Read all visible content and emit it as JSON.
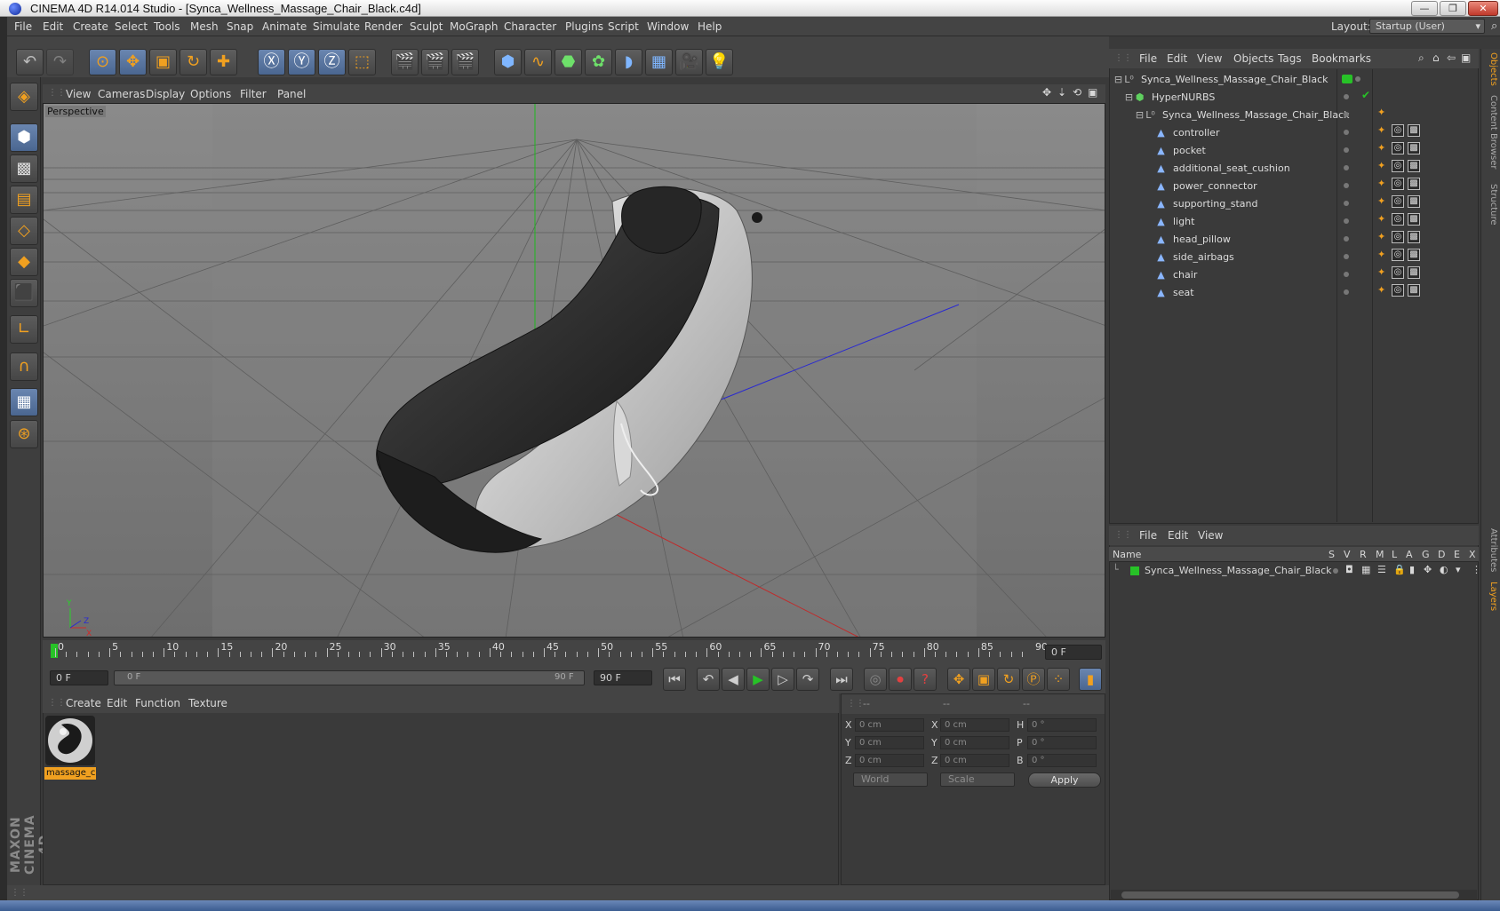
{
  "window": {
    "title": "CINEMA 4D R14.014 Studio - [Synca_Wellness_Massage_Chair_Black.c4d]",
    "minimize": "—",
    "restore": "❐",
    "close": "✕"
  },
  "menubar": {
    "items": [
      "File",
      "Edit",
      "Create",
      "Select",
      "Tools",
      "Mesh",
      "Snap",
      "Animate",
      "Simulate",
      "Render",
      "Sculpt",
      "MoGraph",
      "Character",
      "Plugins",
      "Script",
      "Window",
      "Help"
    ],
    "layout_label": "Layout:",
    "layout_value": "Startup (User)"
  },
  "viewport": {
    "menu": [
      "View",
      "Cameras",
      "Display",
      "Options",
      "Filter",
      "Panel"
    ],
    "label": "Perspective",
    "axis_labels": {
      "x": "X",
      "y": "Y",
      "z": "Z"
    }
  },
  "timeline": {
    "ticks": [
      "0",
      "5",
      "10",
      "15",
      "20",
      "25",
      "30",
      "35",
      "40",
      "45",
      "50",
      "55",
      "60",
      "65",
      "70",
      "75",
      "80",
      "85",
      "90"
    ],
    "current_frame": "0 F",
    "start_field": "0 F",
    "range_start": "0 F",
    "range_end": "90 F",
    "end_field": "90 F",
    "fps_field": "0 F"
  },
  "material_manager": {
    "menu": [
      "Create",
      "Edit",
      "Function",
      "Texture"
    ],
    "materials": [
      {
        "name": "massage_c"
      }
    ]
  },
  "coordinates": {
    "col_headers": [
      "--",
      "--",
      "--"
    ],
    "pos": {
      "x": "0 cm",
      "y": "0 cm",
      "z": "0 cm"
    },
    "size": {
      "x": "0 cm",
      "y": "0 cm",
      "z": "0 cm"
    },
    "rot": {
      "h": "0 °",
      "p": "0 °",
      "b": "0 °"
    },
    "labels": {
      "x": "X",
      "y": "Y",
      "z": "Z",
      "h": "H",
      "p": "P",
      "b": "B"
    },
    "world_select": "World",
    "scale_select": "Scale",
    "apply": "Apply"
  },
  "object_manager": {
    "menu": [
      "File",
      "Edit",
      "View",
      "Objects",
      "Tags",
      "Bookmarks"
    ],
    "objects": [
      {
        "name": "Synca_Wellness_Massage_Chair_Black",
        "depth": 0,
        "type": "null"
      },
      {
        "name": "HyperNURBS",
        "depth": 1,
        "type": "nurbs"
      },
      {
        "name": "Synca_Wellness_Massage_Chair_Black",
        "depth": 2,
        "type": "null"
      },
      {
        "name": "controller",
        "depth": 3,
        "type": "mesh"
      },
      {
        "name": "pocket",
        "depth": 3,
        "type": "mesh"
      },
      {
        "name": "additional_seat_cushion",
        "depth": 3,
        "type": "mesh"
      },
      {
        "name": "power_connector",
        "depth": 3,
        "type": "mesh"
      },
      {
        "name": "supporting_stand",
        "depth": 3,
        "type": "mesh"
      },
      {
        "name": "light",
        "depth": 3,
        "type": "mesh"
      },
      {
        "name": "head_pillow",
        "depth": 3,
        "type": "mesh"
      },
      {
        "name": "side_airbags",
        "depth": 3,
        "type": "mesh"
      },
      {
        "name": "chair",
        "depth": 3,
        "type": "mesh"
      },
      {
        "name": "seat",
        "depth": 3,
        "type": "mesh"
      }
    ]
  },
  "layer_manager": {
    "menu": [
      "File",
      "Edit",
      "View"
    ],
    "columns": [
      "Name",
      "S",
      "V",
      "R",
      "M",
      "L",
      "A",
      "G",
      "D",
      "E",
      "X"
    ],
    "layers": [
      {
        "name": "Synca_Wellness_Massage_Chair_Black",
        "color": "#27c227"
      }
    ]
  },
  "side_tabs": [
    "Objects",
    "Content Browser",
    "Structure",
    "Attributes",
    "Layers"
  ],
  "brand": "MAXON CINEMA 4D",
  "colors": {
    "accent": "#f0a020",
    "selection": "#6a86b0",
    "layer_green": "#27c227"
  }
}
